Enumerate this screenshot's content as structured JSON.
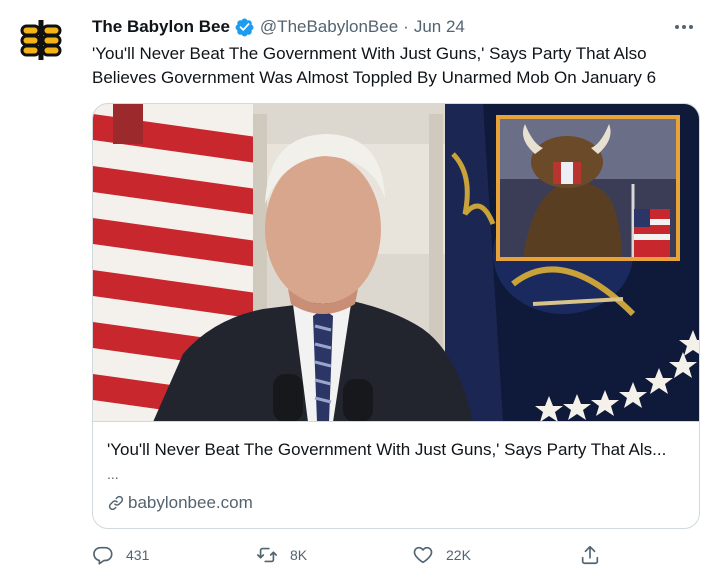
{
  "author": {
    "display_name": "The Babylon Bee",
    "handle": "@TheBabylonBee",
    "separator": "·",
    "date": "Jun 24",
    "avatar_icon": "babylon-bee-logo",
    "verified_icon": "verified-badge-icon"
  },
  "tweet": {
    "text": "'You'll Never Beat The Government With Just Guns,' Says Party That Also Believes Government Was Almost Toppled By Unarmed Mob On January 6"
  },
  "card": {
    "title": "'You'll Never Beat The Government With Just Guns,' Says Party That Als...",
    "description": "...",
    "domain": "babylonbee.com",
    "image": "photo-composite-flag-podium-inset"
  },
  "actions": {
    "reply_count": "431",
    "retweet_count": "8K",
    "like_count": "22K"
  },
  "colors": {
    "text_primary": "#0f1419",
    "text_secondary": "#536471",
    "border": "#cfd9de",
    "verified_blue": "#1d9bf0",
    "brand_yellow": "#f5b416"
  }
}
